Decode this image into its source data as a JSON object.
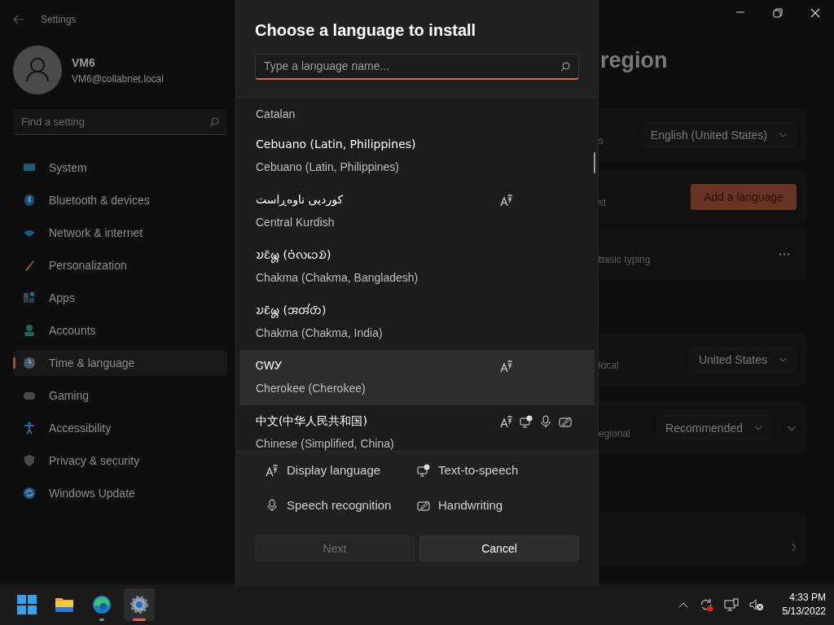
{
  "window": {
    "title": "Settings"
  },
  "user": {
    "name": "VM6",
    "email": "VM6@collabnet.local"
  },
  "search": {
    "placeholder": "Find a setting"
  },
  "nav": [
    {
      "label": "System",
      "selected": false
    },
    {
      "label": "Bluetooth & devices",
      "selected": false
    },
    {
      "label": "Network & internet",
      "selected": false
    },
    {
      "label": "Personalization",
      "selected": false
    },
    {
      "label": "Apps",
      "selected": false
    },
    {
      "label": "Accounts",
      "selected": false
    },
    {
      "label": "Time & language",
      "selected": true
    },
    {
      "label": "Gaming",
      "selected": false
    },
    {
      "label": "Accessibility",
      "selected": false
    },
    {
      "label": "Privacy & security",
      "selected": false
    },
    {
      "label": "Windows Update",
      "selected": false
    }
  ],
  "page": {
    "heading": "region",
    "rows": [
      {
        "kind": "dropdown",
        "label": "s",
        "value": "English (United States)"
      },
      {
        "kind": "button",
        "label": "st",
        "value": "Add a language"
      },
      {
        "kind": "more",
        "label": "basic typing"
      },
      {
        "kind": "dropdown",
        "label": "local",
        "value": "United States"
      },
      {
        "kind": "dropdown-expand",
        "label": "egional",
        "value": "Recommended"
      },
      {
        "kind": "link"
      }
    ]
  },
  "dialog": {
    "title": "Choose a language to install",
    "search_placeholder": "Type a language name...",
    "languages": [
      {
        "english": "Catalan",
        "display": false,
        "tts": false,
        "speech": false,
        "handwriting": false,
        "hovered": false
      },
      {
        "native": "Cebuano (Latin, Philippines)",
        "english": "Cebuano (Latin, Philippines)",
        "display": false,
        "tts": false,
        "speech": false,
        "handwriting": false,
        "hovered": false
      },
      {
        "native": "کوردیی ناوەڕاست",
        "english": "Central Kurdish",
        "display": true,
        "tts": false,
        "speech": false,
        "handwriting": false,
        "hovered": false
      },
      {
        "native": "𑄌𑄋𑄴𑄟𑄳𑄦 (𑄝𑄁𑄣𑄘𑄬𑄌𑄴)",
        "english": "Chakma (Chakma, Bangladesh)",
        "display": false,
        "tts": false,
        "speech": false,
        "handwriting": false,
        "hovered": false
      },
      {
        "native": "𑄌𑄋𑄴𑄟𑄳𑄦 (𑄞𑄢𑄧𑄖𑄴)",
        "english": "Chakma (Chakma, India)",
        "display": false,
        "tts": false,
        "speech": false,
        "handwriting": false,
        "hovered": false
      },
      {
        "native": "ᏣᎳᎩ",
        "english": "Cherokee (Cherokee)",
        "display": true,
        "tts": false,
        "speech": false,
        "handwriting": false,
        "hovered": true
      },
      {
        "native": "中文(中华人民共和国)",
        "english": "Chinese (Simplified, China)",
        "display": true,
        "tts": true,
        "speech": true,
        "handwriting": true,
        "hovered": false
      }
    ],
    "legend": [
      {
        "kind": "display",
        "label": "Display language"
      },
      {
        "kind": "tts",
        "label": "Text-to-speech"
      },
      {
        "kind": "speech",
        "label": "Speech recognition"
      },
      {
        "kind": "handwriting",
        "label": "Handwriting"
      }
    ],
    "buttons": [
      {
        "label": "Next",
        "disabled": true
      },
      {
        "label": "Cancel",
        "disabled": false
      }
    ]
  },
  "taskbar": {
    "time": "4:33 PM",
    "date": "5/13/2022"
  }
}
